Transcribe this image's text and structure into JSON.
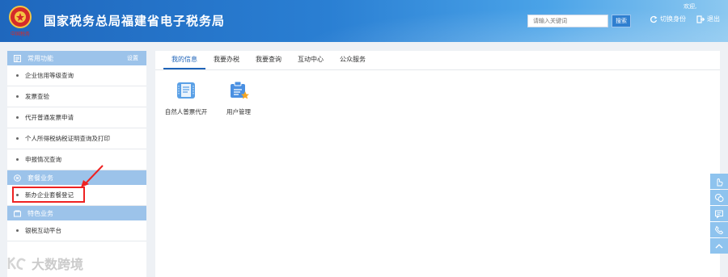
{
  "header": {
    "site_title": "国家税务总局福建省电子税务局",
    "logo_text": "中国税务",
    "welcome": "欢迎,",
    "search": {
      "placeholder": "请输入关键词",
      "button": "搜索"
    },
    "switch_identity": "切换身份",
    "logout": "退出"
  },
  "sidebar": {
    "groups": [
      {
        "title": "常用功能",
        "setting_label": "设置",
        "items": [
          "企业信用等级查询",
          "发票查验",
          "代开普通发票申请",
          "个人所得税纳税证明查询及打印",
          "申报情况查询"
        ]
      },
      {
        "title": "套餐业务",
        "items": [
          "新办企业套餐登记"
        ]
      },
      {
        "title": "特色业务",
        "items": [
          "银税互动平台"
        ]
      }
    ]
  },
  "main": {
    "tabs": [
      "我的信息",
      "我要办税",
      "我要查询",
      "互动中心",
      "公众服务"
    ],
    "active_tab": 0,
    "tiles": [
      {
        "label": "自然人普票代开",
        "icon": "invoice-card-icon"
      },
      {
        "label": "用户管理",
        "icon": "user-management-icon"
      }
    ]
  },
  "float_toolbar": {
    "icons": [
      "hand-pointer-icon",
      "chat-bubbles-icon",
      "message-icon",
      "phone-icon",
      "back-to-top-icon"
    ]
  },
  "watermark": "大数跨境",
  "colors": {
    "header_blue": "#1f67bd",
    "sidebar_header": "#9cc3ea",
    "active_tab": "#1e63b8",
    "highlight": "#e22222"
  }
}
